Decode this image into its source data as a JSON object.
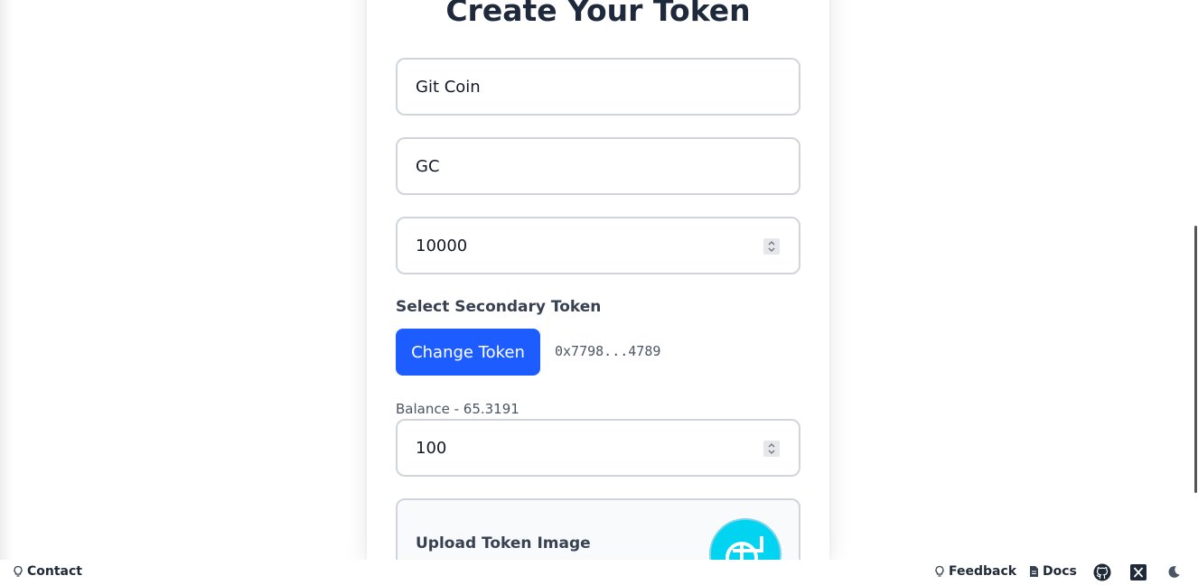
{
  "form": {
    "title": "Create Your Token",
    "token_name_value": "Git Coin",
    "token_symbol_value": "GC",
    "total_supply_value": "10000",
    "secondary_token_label": "Select Secondary Token",
    "change_token_button": "Change Token",
    "secondary_token_address": "0x7798...4789",
    "balance_text": "Balance - 65.3191",
    "secondary_amount_value": "100",
    "upload_label": "Upload Token Image"
  },
  "footer": {
    "contact": "Contact",
    "feedback": "Feedback",
    "docs": "Docs"
  },
  "colors": {
    "primary_button": "#1d5cff",
    "token_image_bg": "#00d4f0"
  },
  "icons": [
    "lightbulb-icon",
    "document-icon",
    "github-icon",
    "x-icon",
    "moon-icon",
    "spinner-arrows-icon"
  ]
}
